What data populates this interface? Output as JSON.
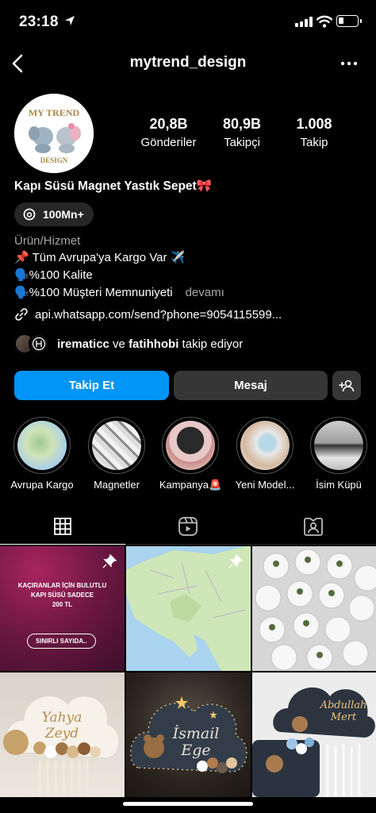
{
  "status": {
    "time": "23:18"
  },
  "header": {
    "username": "mytrend_design"
  },
  "avatar": {
    "logo_line1": "MY TREND",
    "logo_line2": "DESIGN"
  },
  "stats": [
    {
      "value": "20,8B",
      "label": "Gönderiler"
    },
    {
      "value": "80,9B",
      "label": "Takipçi"
    },
    {
      "value": "1.008",
      "label": "Takip"
    }
  ],
  "bio": {
    "name": "Kapı Süsü Magnet Yastık Sepet🎀",
    "threads_badge": "100Mn+",
    "category": "Ürün/Hizmet",
    "lines": [
      "📌 Tüm Avrupa'ya Kargo Var ✈️",
      "🗣️%100 Kalite",
      "🗣️%100 Müşteri Memnuniyeti"
    ],
    "more": "devamı",
    "link": "api.whatsapp.com/send?phone=9054115599...",
    "followed_by_1": "irematicc",
    "followed_by_and": " ve ",
    "followed_by_2": "fatihhobi",
    "followed_by_suffix": " takip ediyor"
  },
  "buttons": {
    "follow": "Takip Et",
    "message": "Mesaj"
  },
  "highlights": [
    {
      "label": "Avrupa Kargo"
    },
    {
      "label": "Magnetler"
    },
    {
      "label": "Kampanya🚨"
    },
    {
      "label": "Yeni Model..."
    },
    {
      "label": "İsim Küpü"
    }
  ],
  "posts": [
    {
      "line1": "KAÇIRANLAR İÇİN BULUTLU",
      "line2": "KAPI SÜSÜ SADECE",
      "line3": "200 TL",
      "line4": "SINIRLI SAYIDA.."
    },
    {
      "name1": "Yahya",
      "name2": "Zeyd"
    },
    {
      "name1": "İsmail",
      "name2": "Ege"
    },
    {
      "name1": "Abdullah",
      "name2": "Mert"
    }
  ],
  "colors": {
    "accent": "#0095f6",
    "button_dark": "#363636",
    "background": "#000000"
  }
}
